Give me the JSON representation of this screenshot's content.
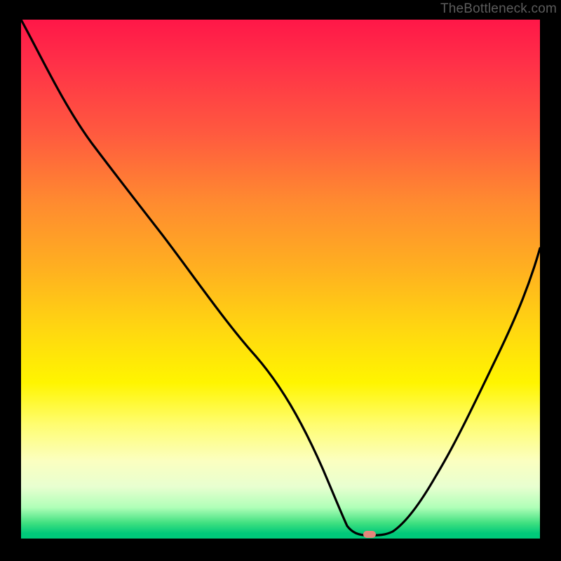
{
  "watermark": "TheBottleneck.com",
  "chart_data": {
    "type": "line",
    "title": "",
    "xlabel": "",
    "ylabel": "",
    "xlim": [
      0,
      100
    ],
    "ylim": [
      0,
      100
    ],
    "curve": {
      "x": [
        0,
        10,
        20,
        27,
        35,
        45,
        55,
        60,
        63,
        66,
        70,
        75,
        80,
        86,
        92,
        100
      ],
      "y": [
        100,
        86,
        72,
        63,
        49.5,
        31,
        12.5,
        4,
        1.1,
        0.3,
        0.3,
        1.8,
        7.5,
        19,
        34,
        56
      ]
    },
    "marker": {
      "x": 67,
      "y": 0.6,
      "color": "#e4877b",
      "label": ""
    },
    "gradient_stops": [
      {
        "pos": 0,
        "color": "#ff1748"
      },
      {
        "pos": 22,
        "color": "#ff5a3f"
      },
      {
        "pos": 48,
        "color": "#ffb020"
      },
      {
        "pos": 70,
        "color": "#fff500"
      },
      {
        "pos": 90,
        "color": "#e8ffd0"
      },
      {
        "pos": 100,
        "color": "#00c97a"
      }
    ]
  }
}
